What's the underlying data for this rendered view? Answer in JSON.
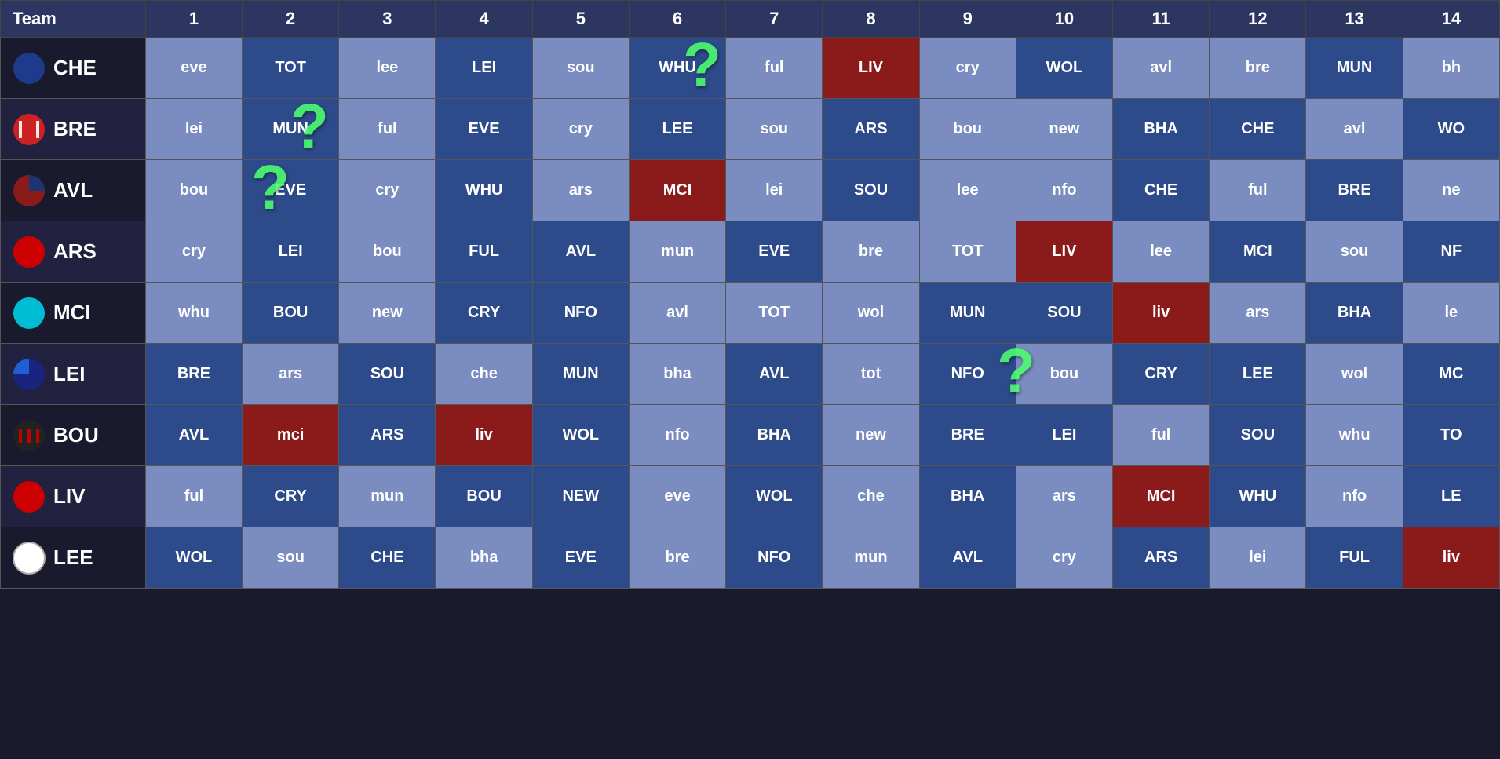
{
  "header": {
    "team_label": "Team",
    "columns": [
      "1",
      "2",
      "3",
      "4",
      "5",
      "6",
      "7",
      "8",
      "9",
      "10",
      "11",
      "12",
      "13",
      "14"
    ]
  },
  "teams": [
    {
      "abbr": "CHE",
      "badge_color": "#1e3a8a",
      "badge_type": "full",
      "fixtures": [
        {
          "text": "eve",
          "style": "away"
        },
        {
          "text": "TOT",
          "style": "home"
        },
        {
          "text": "lee",
          "style": "away"
        },
        {
          "text": "LEI",
          "style": "home"
        },
        {
          "text": "sou",
          "style": "away"
        },
        {
          "text": "WHU",
          "style": "home"
        },
        {
          "text": "ful",
          "style": "away"
        },
        {
          "text": "LIV",
          "style": "danger"
        },
        {
          "text": "cry",
          "style": "away"
        },
        {
          "text": "WOL",
          "style": "home"
        },
        {
          "text": "avl",
          "style": "away"
        },
        {
          "text": "bre",
          "style": "away"
        },
        {
          "text": "MUN",
          "style": "home"
        },
        {
          "text": "bh",
          "style": "away"
        }
      ]
    },
    {
      "abbr": "BRE",
      "badge_color": "#cc2222",
      "badge_type": "striped",
      "fixtures": [
        {
          "text": "lei",
          "style": "away"
        },
        {
          "text": "MUN",
          "style": "home"
        },
        {
          "text": "ful",
          "style": "away"
        },
        {
          "text": "EVE",
          "style": "home"
        },
        {
          "text": "cry",
          "style": "away"
        },
        {
          "text": "LEE",
          "style": "home"
        },
        {
          "text": "sou",
          "style": "away"
        },
        {
          "text": "ARS",
          "style": "home"
        },
        {
          "text": "bou",
          "style": "away"
        },
        {
          "text": "new",
          "style": "away"
        },
        {
          "text": "BHA",
          "style": "home"
        },
        {
          "text": "CHE",
          "style": "home"
        },
        {
          "text": "avl",
          "style": "away"
        },
        {
          "text": "WO",
          "style": "home"
        }
      ]
    },
    {
      "abbr": "AVL",
      "badge_color": "#8b1a1a",
      "badge_type": "half",
      "fixtures": [
        {
          "text": "bou",
          "style": "away"
        },
        {
          "text": "EVE",
          "style": "home"
        },
        {
          "text": "cry",
          "style": "away"
        },
        {
          "text": "WHU",
          "style": "home"
        },
        {
          "text": "ars",
          "style": "away"
        },
        {
          "text": "MCI",
          "style": "danger"
        },
        {
          "text": "lei",
          "style": "away"
        },
        {
          "text": "SOU",
          "style": "home"
        },
        {
          "text": "lee",
          "style": "away"
        },
        {
          "text": "nfo",
          "style": "away"
        },
        {
          "text": "CHE",
          "style": "home"
        },
        {
          "text": "ful",
          "style": "away"
        },
        {
          "text": "BRE",
          "style": "home"
        },
        {
          "text": "ne",
          "style": "away"
        }
      ]
    },
    {
      "abbr": "ARS",
      "badge_color": "#cc0000",
      "badge_type": "red",
      "fixtures": [
        {
          "text": "cry",
          "style": "away"
        },
        {
          "text": "LEI",
          "style": "home"
        },
        {
          "text": "bou",
          "style": "away"
        },
        {
          "text": "FUL",
          "style": "home"
        },
        {
          "text": "AVL",
          "style": "home"
        },
        {
          "text": "mun",
          "style": "away"
        },
        {
          "text": "EVE",
          "style": "home"
        },
        {
          "text": "bre",
          "style": "away"
        },
        {
          "text": "TOT",
          "style": "away"
        },
        {
          "text": "LIV",
          "style": "danger"
        },
        {
          "text": "lee",
          "style": "away"
        },
        {
          "text": "MCI",
          "style": "home"
        },
        {
          "text": "sou",
          "style": "away"
        },
        {
          "text": "NF",
          "style": "home"
        }
      ]
    },
    {
      "abbr": "MCI",
      "badge_color": "#00bcd4",
      "badge_type": "cyan",
      "fixtures": [
        {
          "text": "whu",
          "style": "away"
        },
        {
          "text": "BOU",
          "style": "home"
        },
        {
          "text": "new",
          "style": "away"
        },
        {
          "text": "CRY",
          "style": "home"
        },
        {
          "text": "NFO",
          "style": "home"
        },
        {
          "text": "avl",
          "style": "away"
        },
        {
          "text": "TOT",
          "style": "away"
        },
        {
          "text": "wol",
          "style": "away"
        },
        {
          "text": "MUN",
          "style": "home"
        },
        {
          "text": "SOU",
          "style": "home"
        },
        {
          "text": "liv",
          "style": "danger"
        },
        {
          "text": "ars",
          "style": "away"
        },
        {
          "text": "BHA",
          "style": "home"
        },
        {
          "text": "le",
          "style": "away"
        }
      ]
    },
    {
      "abbr": "LEI",
      "badge_color": "#1a237e",
      "badge_type": "dark",
      "fixtures": [
        {
          "text": "BRE",
          "style": "home"
        },
        {
          "text": "ars",
          "style": "away"
        },
        {
          "text": "SOU",
          "style": "home"
        },
        {
          "text": "che",
          "style": "away"
        },
        {
          "text": "MUN",
          "style": "home"
        },
        {
          "text": "bha",
          "style": "away"
        },
        {
          "text": "AVL",
          "style": "home"
        },
        {
          "text": "tot",
          "style": "away"
        },
        {
          "text": "NFO",
          "style": "home"
        },
        {
          "text": "bou",
          "style": "away"
        },
        {
          "text": "CRY",
          "style": "home"
        },
        {
          "text": "LEE",
          "style": "home"
        },
        {
          "text": "wol",
          "style": "away"
        },
        {
          "text": "MC",
          "style": "home"
        }
      ]
    },
    {
      "abbr": "BOU",
      "badge_color": "#222222",
      "badge_type": "striped2",
      "fixtures": [
        {
          "text": "AVL",
          "style": "home"
        },
        {
          "text": "mci",
          "style": "danger"
        },
        {
          "text": "ARS",
          "style": "home"
        },
        {
          "text": "liv",
          "style": "danger"
        },
        {
          "text": "WOL",
          "style": "home"
        },
        {
          "text": "nfo",
          "style": "away"
        },
        {
          "text": "BHA",
          "style": "home"
        },
        {
          "text": "new",
          "style": "away"
        },
        {
          "text": "BRE",
          "style": "home"
        },
        {
          "text": "LEI",
          "style": "home"
        },
        {
          "text": "ful",
          "style": "away"
        },
        {
          "text": "SOU",
          "style": "home"
        },
        {
          "text": "whu",
          "style": "away"
        },
        {
          "text": "TO",
          "style": "home"
        }
      ]
    },
    {
      "abbr": "LIV",
      "badge_color": "#cc0000",
      "badge_type": "red2",
      "fixtures": [
        {
          "text": "ful",
          "style": "away"
        },
        {
          "text": "CRY",
          "style": "home"
        },
        {
          "text": "mun",
          "style": "away"
        },
        {
          "text": "BOU",
          "style": "home"
        },
        {
          "text": "NEW",
          "style": "home"
        },
        {
          "text": "eve",
          "style": "away"
        },
        {
          "text": "WOL",
          "style": "home"
        },
        {
          "text": "che",
          "style": "away"
        },
        {
          "text": "BHA",
          "style": "home"
        },
        {
          "text": "ars",
          "style": "away"
        },
        {
          "text": "MCI",
          "style": "danger"
        },
        {
          "text": "WHU",
          "style": "home"
        },
        {
          "text": "nfo",
          "style": "away"
        },
        {
          "text": "LE",
          "style": "home"
        }
      ]
    },
    {
      "abbr": "LEE",
      "badge_color": "#ffffff",
      "badge_type": "white",
      "fixtures": [
        {
          "text": "WOL",
          "style": "home"
        },
        {
          "text": "sou",
          "style": "away"
        },
        {
          "text": "CHE",
          "style": "home"
        },
        {
          "text": "bha",
          "style": "away"
        },
        {
          "text": "EVE",
          "style": "home"
        },
        {
          "text": "bre",
          "style": "away"
        },
        {
          "text": "NFO",
          "style": "home"
        },
        {
          "text": "mun",
          "style": "away"
        },
        {
          "text": "AVL",
          "style": "home"
        },
        {
          "text": "cry",
          "style": "away"
        },
        {
          "text": "ARS",
          "style": "home"
        },
        {
          "text": "lei",
          "style": "away"
        },
        {
          "text": "FUL",
          "style": "home"
        },
        {
          "text": "liv",
          "style": "danger"
        }
      ]
    }
  ],
  "overlays": [
    {
      "row": 0,
      "col": 8,
      "label": "CHE col9 qmark"
    },
    {
      "row": 1,
      "col": 3,
      "label": "BRE col4 qmark"
    },
    {
      "row": 5,
      "col": 12,
      "label": "LEI col13 qmark"
    }
  ]
}
